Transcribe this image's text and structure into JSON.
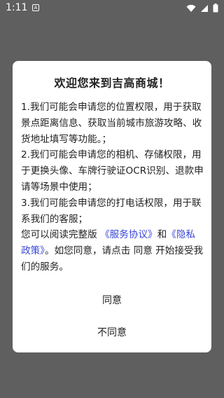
{
  "status_bar": {
    "time": "1:11",
    "notification_glyph": "A",
    "icons": [
      "wifi-icon",
      "signal-icon",
      "battery-icon"
    ]
  },
  "dialog": {
    "title": "欢迎您来到吉高商城！",
    "items": [
      "1.我们可能会申请您的位置权限，用于获取景点距离信息、获取当前城市旅游攻略、收货地址填写等功能。；",
      "2.我们可能会申请您的相机、存储权限，用于更换头像、车牌行驶证OCR识别、退款申请等场景中使用；",
      "3.我们可能会申请您的打电话权限，用于联系我们的客服；"
    ],
    "notice": {
      "prefix": "您可以阅读完整版",
      "service_link": "《服务协议》",
      "and": "和",
      "privacy_link": "《隐私政策》",
      "suffix": "。如您同意，请点击 同意 开始接受我们的服务。"
    },
    "agree_label": "同意",
    "disagree_label": "不同意"
  },
  "colors": {
    "overlay": "#5f5f5f",
    "link": "#3a46d6",
    "text": "#222222"
  }
}
